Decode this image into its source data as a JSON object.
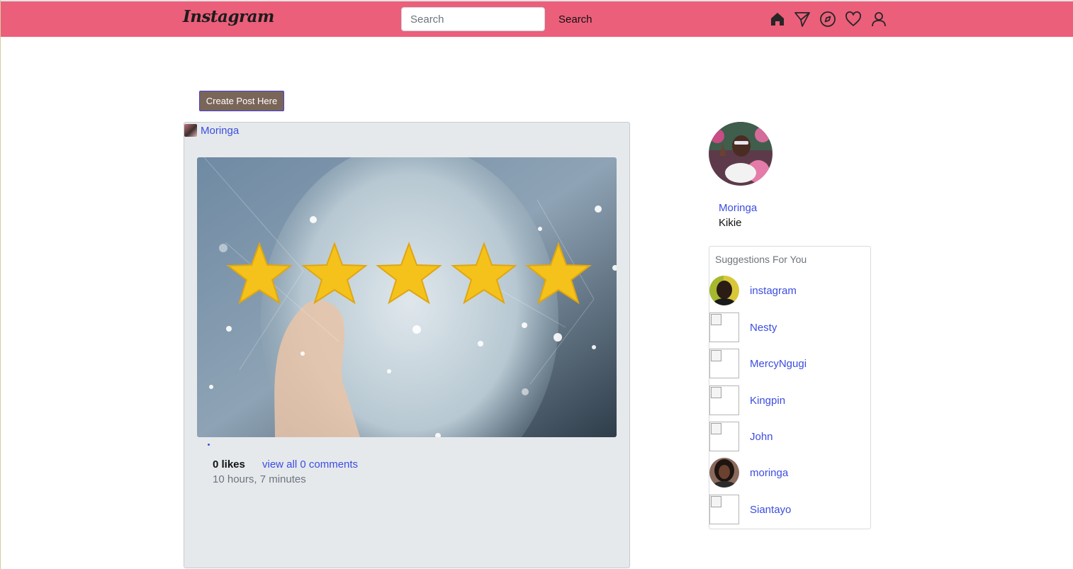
{
  "navbar": {
    "logo": "Instagram",
    "search_placeholder": "Search",
    "search_button": "Search",
    "icons": [
      "home-icon",
      "direct-send-icon",
      "explore-compass-icon",
      "heart-icon",
      "profile-icon"
    ],
    "background": "#eb5f7b"
  },
  "create_post": {
    "label": "Create Post Here"
  },
  "post": {
    "username": "Moringa",
    "likes": "0 likes",
    "comments": "view all 0 comments",
    "timestamp": "10 hours, 7 minutes"
  },
  "profile": {
    "username": "Moringa",
    "name": "Kikie"
  },
  "suggestions": {
    "title": "Suggestions For You",
    "items": [
      {
        "name": "instagram",
        "avatar": "photo"
      },
      {
        "name": "Nesty",
        "avatar": "broken"
      },
      {
        "name": "MercyNgugi",
        "avatar": "broken"
      },
      {
        "name": "Kingpin",
        "avatar": "broken"
      },
      {
        "name": "John",
        "avatar": "broken"
      },
      {
        "name": "moringa",
        "avatar": "photo"
      },
      {
        "name": "Siantayo",
        "avatar": "broken"
      }
    ]
  },
  "colors": {
    "link": "#3b4ddf",
    "star": "#f5c21b"
  }
}
